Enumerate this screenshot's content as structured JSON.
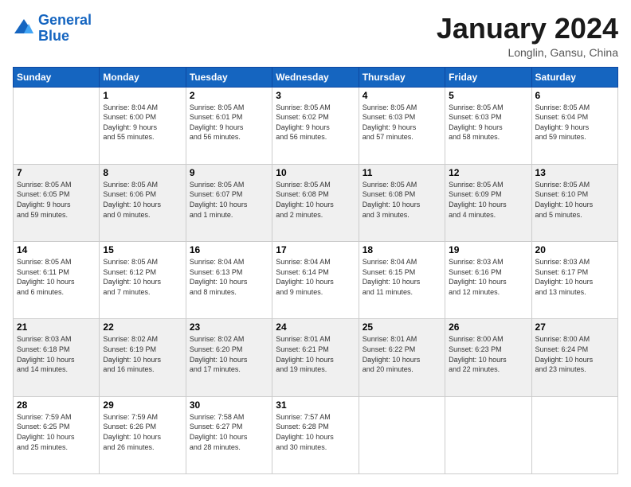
{
  "header": {
    "logo_line1": "General",
    "logo_line2": "Blue",
    "month": "January 2024",
    "location": "Longlin, Gansu, China"
  },
  "weekdays": [
    "Sunday",
    "Monday",
    "Tuesday",
    "Wednesday",
    "Thursday",
    "Friday",
    "Saturday"
  ],
  "weeks": [
    [
      {
        "day": "",
        "info": ""
      },
      {
        "day": "1",
        "info": "Sunrise: 8:04 AM\nSunset: 6:00 PM\nDaylight: 9 hours\nand 55 minutes."
      },
      {
        "day": "2",
        "info": "Sunrise: 8:05 AM\nSunset: 6:01 PM\nDaylight: 9 hours\nand 56 minutes."
      },
      {
        "day": "3",
        "info": "Sunrise: 8:05 AM\nSunset: 6:02 PM\nDaylight: 9 hours\nand 56 minutes."
      },
      {
        "day": "4",
        "info": "Sunrise: 8:05 AM\nSunset: 6:03 PM\nDaylight: 9 hours\nand 57 minutes."
      },
      {
        "day": "5",
        "info": "Sunrise: 8:05 AM\nSunset: 6:03 PM\nDaylight: 9 hours\nand 58 minutes."
      },
      {
        "day": "6",
        "info": "Sunrise: 8:05 AM\nSunset: 6:04 PM\nDaylight: 9 hours\nand 59 minutes."
      }
    ],
    [
      {
        "day": "7",
        "info": "Sunrise: 8:05 AM\nSunset: 6:05 PM\nDaylight: 9 hours\nand 59 minutes."
      },
      {
        "day": "8",
        "info": "Sunrise: 8:05 AM\nSunset: 6:06 PM\nDaylight: 10 hours\nand 0 minutes."
      },
      {
        "day": "9",
        "info": "Sunrise: 8:05 AM\nSunset: 6:07 PM\nDaylight: 10 hours\nand 1 minute."
      },
      {
        "day": "10",
        "info": "Sunrise: 8:05 AM\nSunset: 6:08 PM\nDaylight: 10 hours\nand 2 minutes."
      },
      {
        "day": "11",
        "info": "Sunrise: 8:05 AM\nSunset: 6:08 PM\nDaylight: 10 hours\nand 3 minutes."
      },
      {
        "day": "12",
        "info": "Sunrise: 8:05 AM\nSunset: 6:09 PM\nDaylight: 10 hours\nand 4 minutes."
      },
      {
        "day": "13",
        "info": "Sunrise: 8:05 AM\nSunset: 6:10 PM\nDaylight: 10 hours\nand 5 minutes."
      }
    ],
    [
      {
        "day": "14",
        "info": "Sunrise: 8:05 AM\nSunset: 6:11 PM\nDaylight: 10 hours\nand 6 minutes."
      },
      {
        "day": "15",
        "info": "Sunrise: 8:05 AM\nSunset: 6:12 PM\nDaylight: 10 hours\nand 7 minutes."
      },
      {
        "day": "16",
        "info": "Sunrise: 8:04 AM\nSunset: 6:13 PM\nDaylight: 10 hours\nand 8 minutes."
      },
      {
        "day": "17",
        "info": "Sunrise: 8:04 AM\nSunset: 6:14 PM\nDaylight: 10 hours\nand 9 minutes."
      },
      {
        "day": "18",
        "info": "Sunrise: 8:04 AM\nSunset: 6:15 PM\nDaylight: 10 hours\nand 11 minutes."
      },
      {
        "day": "19",
        "info": "Sunrise: 8:03 AM\nSunset: 6:16 PM\nDaylight: 10 hours\nand 12 minutes."
      },
      {
        "day": "20",
        "info": "Sunrise: 8:03 AM\nSunset: 6:17 PM\nDaylight: 10 hours\nand 13 minutes."
      }
    ],
    [
      {
        "day": "21",
        "info": "Sunrise: 8:03 AM\nSunset: 6:18 PM\nDaylight: 10 hours\nand 14 minutes."
      },
      {
        "day": "22",
        "info": "Sunrise: 8:02 AM\nSunset: 6:19 PM\nDaylight: 10 hours\nand 16 minutes."
      },
      {
        "day": "23",
        "info": "Sunrise: 8:02 AM\nSunset: 6:20 PM\nDaylight: 10 hours\nand 17 minutes."
      },
      {
        "day": "24",
        "info": "Sunrise: 8:01 AM\nSunset: 6:21 PM\nDaylight: 10 hours\nand 19 minutes."
      },
      {
        "day": "25",
        "info": "Sunrise: 8:01 AM\nSunset: 6:22 PM\nDaylight: 10 hours\nand 20 minutes."
      },
      {
        "day": "26",
        "info": "Sunrise: 8:00 AM\nSunset: 6:23 PM\nDaylight: 10 hours\nand 22 minutes."
      },
      {
        "day": "27",
        "info": "Sunrise: 8:00 AM\nSunset: 6:24 PM\nDaylight: 10 hours\nand 23 minutes."
      }
    ],
    [
      {
        "day": "28",
        "info": "Sunrise: 7:59 AM\nSunset: 6:25 PM\nDaylight: 10 hours\nand 25 minutes."
      },
      {
        "day": "29",
        "info": "Sunrise: 7:59 AM\nSunset: 6:26 PM\nDaylight: 10 hours\nand 26 minutes."
      },
      {
        "day": "30",
        "info": "Sunrise: 7:58 AM\nSunset: 6:27 PM\nDaylight: 10 hours\nand 28 minutes."
      },
      {
        "day": "31",
        "info": "Sunrise: 7:57 AM\nSunset: 6:28 PM\nDaylight: 10 hours\nand 30 minutes."
      },
      {
        "day": "",
        "info": ""
      },
      {
        "day": "",
        "info": ""
      },
      {
        "day": "",
        "info": ""
      }
    ]
  ]
}
